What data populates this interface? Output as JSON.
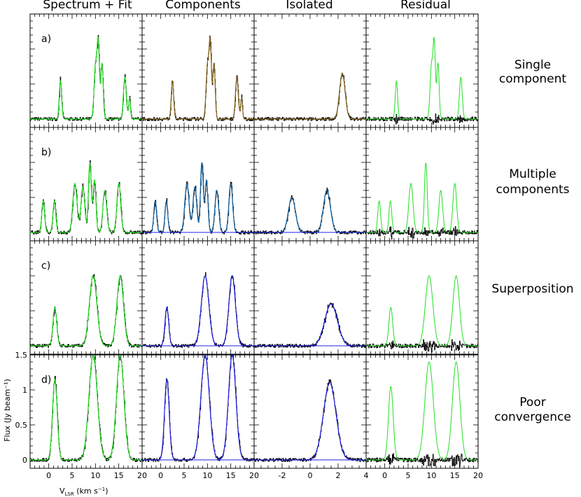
{
  "figure": {
    "columns": [
      "Spectrum + Fit",
      "Components",
      "Isolated",
      "Residual"
    ],
    "rows": [
      {
        "panel": "a)",
        "label": [
          "Single",
          "component"
        ]
      },
      {
        "panel": "b)",
        "label": [
          "Multiple",
          "components"
        ]
      },
      {
        "panel": "c)",
        "label": [
          "Superposition"
        ]
      },
      {
        "panel": "d)",
        "label": [
          "Poor",
          "convergence"
        ]
      }
    ],
    "xlabel_main": "V",
    "xlabel_sub": "LSR",
    "xlabel_units": " (km s",
    "xlabel_exp": "−1",
    "xlabel_close": ")",
    "ylabel": "Flux (Jy beam⁻¹)"
  },
  "colors": {
    "spectrum": "#000000",
    "fit": "#22e022",
    "component_a": "#d02020",
    "component_b": "#8a6a1e",
    "component_c": "#1060a0",
    "component_blue": "#2020e0",
    "component_red": "#ff2020"
  },
  "chart_data": [
    {
      "type": "line",
      "title": "Spectrum + Fit",
      "xlabel": "VLSR (km s-1)",
      "ylabel": "Flux (Jy beam-1)",
      "xlim": [
        -4,
        20
      ],
      "xticks": [
        0,
        5,
        10,
        15,
        20
      ],
      "ylim": [
        -0.12,
        1.5
      ],
      "yticks": [
        0,
        0.5,
        1,
        1.5
      ],
      "panels": [
        {
          "panel": "a)",
          "peaks": [
            {
              "x": 2.5,
              "height": 0.55,
              "width": 0.25
            },
            {
              "x": 10.0,
              "height": 0.75,
              "width": 0.3
            },
            {
              "x": 10.6,
              "height": 1.05,
              "width": 0.25
            },
            {
              "x": 11.4,
              "height": 0.8,
              "width": 0.25
            },
            {
              "x": 16.3,
              "height": 0.6,
              "width": 0.3
            },
            {
              "x": 17.3,
              "height": 0.3,
              "width": 0.2
            }
          ]
        },
        {
          "panel": "b)",
          "peaks": [
            {
              "x": -1.2,
              "height": 0.45,
              "width": 0.3
            },
            {
              "x": 1.2,
              "height": 0.45,
              "width": 0.3
            },
            {
              "x": 5.6,
              "height": 0.7,
              "width": 0.45
            },
            {
              "x": 7.3,
              "height": 0.65,
              "width": 0.4
            },
            {
              "x": 8.8,
              "height": 1.0,
              "width": 0.3
            },
            {
              "x": 9.8,
              "height": 0.75,
              "width": 0.3
            },
            {
              "x": 12.0,
              "height": 0.6,
              "width": 0.4
            },
            {
              "x": 15.0,
              "height": 0.7,
              "width": 0.4
            }
          ]
        },
        {
          "panel": "c)",
          "peaks": [
            {
              "x": 1.3,
              "height": 0.55,
              "width": 0.4
            },
            {
              "x": 9.5,
              "height": 1.0,
              "width": 0.8
            },
            {
              "x": 15.3,
              "height": 1.0,
              "width": 0.7
            }
          ]
        },
        {
          "panel": "d)",
          "peaks": [
            {
              "x": 1.3,
              "height": 1.15,
              "width": 0.5
            },
            {
              "x": 9.5,
              "height": 1.5,
              "width": 0.9
            },
            {
              "x": 15.3,
              "height": 1.5,
              "width": 0.8
            }
          ]
        }
      ]
    },
    {
      "type": "line",
      "title": "Components",
      "xlim": [
        -4,
        20
      ],
      "xticks": [
        0,
        5,
        10,
        15,
        20
      ],
      "ylim": [
        -0.12,
        1.5
      ],
      "panels": [
        {
          "panel": "a)",
          "peaks": [
            {
              "x": 2.5,
              "height": 0.55,
              "width": 0.25
            },
            {
              "x": 10.0,
              "height": 0.75,
              "width": 0.3
            },
            {
              "x": 10.6,
              "height": 1.05,
              "width": 0.25
            },
            {
              "x": 11.4,
              "height": 0.8,
              "width": 0.25
            },
            {
              "x": 16.3,
              "height": 0.6,
              "width": 0.3
            },
            {
              "x": 17.3,
              "height": 0.3,
              "width": 0.2
            }
          ]
        },
        {
          "panel": "b)",
          "peaks": [
            {
              "x": -1.2,
              "height": 0.45,
              "width": 0.3
            },
            {
              "x": 1.2,
              "height": 0.45,
              "width": 0.3
            },
            {
              "x": 5.6,
              "height": 0.7,
              "width": 0.45
            },
            {
              "x": 7.3,
              "height": 0.65,
              "width": 0.4
            },
            {
              "x": 8.8,
              "height": 1.0,
              "width": 0.3
            },
            {
              "x": 9.8,
              "height": 0.75,
              "width": 0.3
            },
            {
              "x": 12.0,
              "height": 0.6,
              "width": 0.4
            },
            {
              "x": 15.0,
              "height": 0.7,
              "width": 0.4
            }
          ]
        },
        {
          "panel": "c)",
          "peaks": [
            {
              "x": 1.3,
              "height": 0.55,
              "width": 0.4
            },
            {
              "x": 9.5,
              "height": 1.0,
              "width": 0.8
            },
            {
              "x": 15.3,
              "height": 1.0,
              "width": 0.7
            }
          ]
        },
        {
          "panel": "d)",
          "peaks": [
            {
              "x": 1.3,
              "height": 1.15,
              "width": 0.5
            },
            {
              "x": 9.5,
              "height": 1.5,
              "width": 0.9
            },
            {
              "x": 15.3,
              "height": 1.5,
              "width": 0.8
            }
          ]
        }
      ]
    },
    {
      "type": "line",
      "title": "Isolated",
      "xlim": [
        -4,
        4
      ],
      "xticks": [
        -2,
        0,
        2,
        4
      ],
      "ylim": [
        -0.12,
        1.5
      ],
      "panels": [
        {
          "panel": "a)",
          "peaks": [
            {
              "x": 2.3,
              "height": 0.65,
              "width": 0.2
            }
          ]
        },
        {
          "panel": "b)",
          "peaks": [
            {
              "x": -1.3,
              "height": 0.5,
              "width": 0.25
            },
            {
              "x": 1.2,
              "height": 0.6,
              "width": 0.25
            }
          ]
        },
        {
          "panel": "c)",
          "peaks": [
            {
              "x": 1.5,
              "height": 0.6,
              "width": 0.45
            }
          ]
        },
        {
          "panel": "d)",
          "peaks": [
            {
              "x": 1.4,
              "height": 1.1,
              "width": 0.45
            }
          ]
        }
      ]
    },
    {
      "type": "line",
      "title": "Residual",
      "xlim": [
        -4,
        20
      ],
      "xticks": [
        0,
        5,
        10,
        15,
        20
      ],
      "ylim": [
        -0.12,
        1.5
      ],
      "panels": [
        {
          "panel": "a)",
          "peaks": [
            {
              "x": 2.5,
              "height": 0.55,
              "width": 0.25
            },
            {
              "x": 10.0,
              "height": 0.75,
              "width": 0.3
            },
            {
              "x": 10.6,
              "height": 1.05,
              "width": 0.25
            },
            {
              "x": 11.4,
              "height": 0.8,
              "width": 0.25
            },
            {
              "x": 16.3,
              "height": 0.6,
              "width": 0.3
            }
          ]
        },
        {
          "panel": "b)",
          "peaks": [
            {
              "x": -1.2,
              "height": 0.45,
              "width": 0.3
            },
            {
              "x": 1.2,
              "height": 0.45,
              "width": 0.3
            },
            {
              "x": 5.6,
              "height": 0.7,
              "width": 0.45
            },
            {
              "x": 8.8,
              "height": 1.0,
              "width": 0.3
            },
            {
              "x": 12.0,
              "height": 0.6,
              "width": 0.4
            },
            {
              "x": 15.0,
              "height": 0.7,
              "width": 0.4
            }
          ]
        },
        {
          "panel": "c)",
          "peaks": [
            {
              "x": 1.3,
              "height": 0.55,
              "width": 0.4
            },
            {
              "x": 9.5,
              "height": 1.0,
              "width": 0.8
            },
            {
              "x": 15.3,
              "height": 1.0,
              "width": 0.7
            }
          ]
        },
        {
          "panel": "d)",
          "peaks": [
            {
              "x": 1.3,
              "height": 1.05,
              "width": 0.5
            },
            {
              "x": 9.5,
              "height": 1.4,
              "width": 0.9
            },
            {
              "x": 15.3,
              "height": 1.4,
              "width": 0.8
            }
          ]
        }
      ]
    }
  ]
}
